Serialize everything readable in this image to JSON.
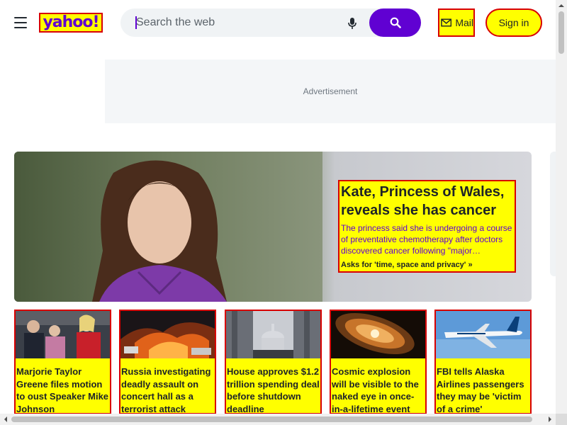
{
  "header": {
    "logo_text": "yahoo!",
    "search_placeholder": "Search the web",
    "mail_label": "Mail",
    "signin_label": "Sign in"
  },
  "ad": {
    "label": "Advertisement"
  },
  "hero": {
    "title": "Kate, Princess of Wales, reveals she has cancer",
    "summary": "The princess said she is undergoing a course of preventative chemotherapy after doctors discovered cancer following \"major…",
    "link": "Asks for 'time, space and privacy' »"
  },
  "stories": [
    {
      "title": "Marjorie Taylor Greene files motion to oust Speaker Mike Johnson"
    },
    {
      "title": "Russia investigating deadly assault on concert hall as a terrorist attack"
    },
    {
      "title": "House approves $1.2 trillion spending deal before shutdown deadline"
    },
    {
      "title": "Cosmic explosion will be visible to the naked eye in once-in-a-lifetime event"
    },
    {
      "title": "FBI tells Alaska Airlines passengers they may be 'victim of a crime'"
    }
  ],
  "colors": {
    "brand_purple": "#6001d2",
    "highlight_yellow": "#ffff00",
    "highlight_border": "#d80000"
  },
  "icons": [
    "menu-icon",
    "microphone-icon",
    "search-icon",
    "mail-icon"
  ]
}
